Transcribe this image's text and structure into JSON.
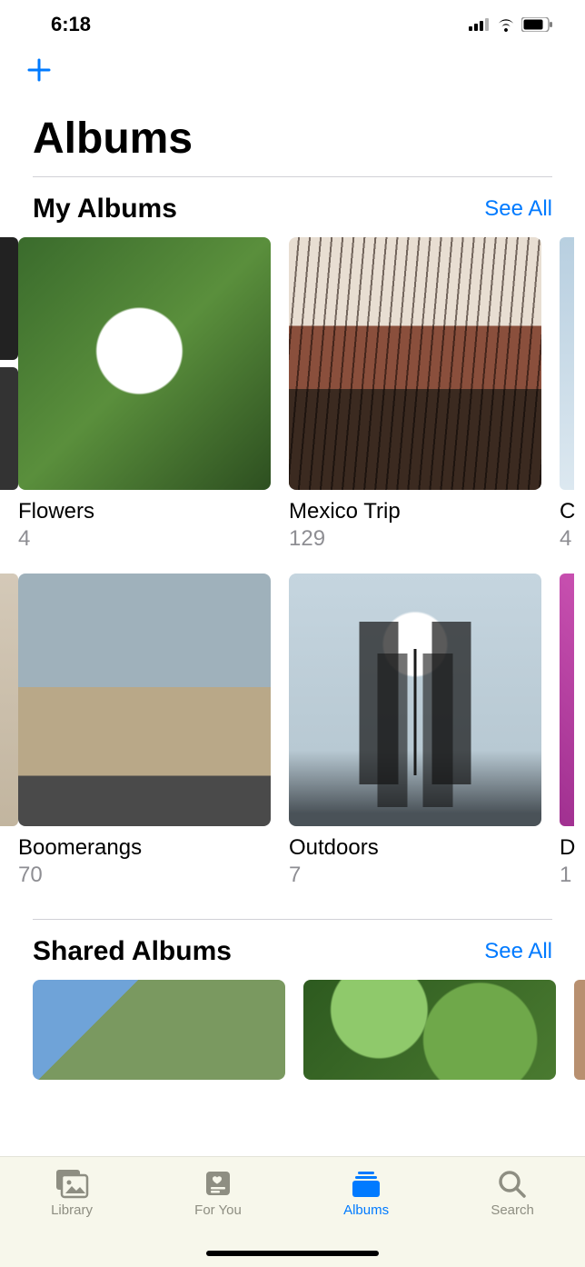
{
  "status": {
    "time": "6:18"
  },
  "header": {
    "title": "Albums"
  },
  "sections": {
    "my_albums": {
      "title": "My Albums",
      "see_all": "See All",
      "row1": [
        {
          "name": "Flowers",
          "count": "4"
        },
        {
          "name": "Mexico Trip",
          "count": "129"
        },
        {
          "name_peek": "C",
          "count_peek": "4"
        }
      ],
      "row2": [
        {
          "name": "Boomerangs",
          "count": "70"
        },
        {
          "name": "Outdoors",
          "count": "7"
        },
        {
          "name_peek": "D",
          "count_peek": "1"
        }
      ]
    },
    "shared_albums": {
      "title": "Shared Albums",
      "see_all": "See All"
    }
  },
  "tabs": {
    "library": "Library",
    "for_you": "For You",
    "albums": "Albums",
    "search": "Search"
  }
}
